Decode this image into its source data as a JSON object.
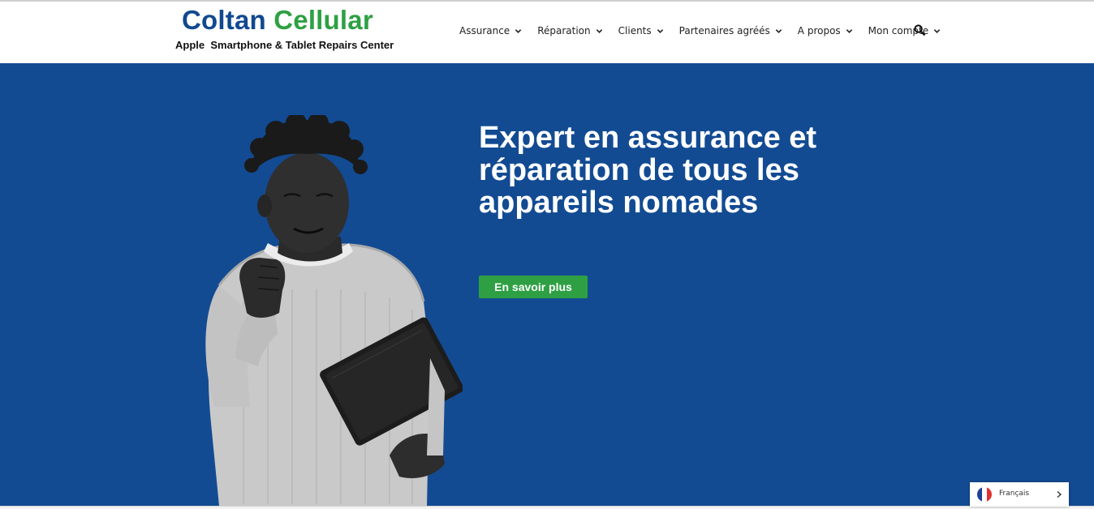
{
  "header": {
    "logo": {
      "title_word1": "Coltan",
      "title_word2": "Cellular",
      "subtitle": "Apple  Smartphone & Tablet Repairs Center"
    },
    "nav": [
      {
        "label": "Assurance",
        "icon": "chevron-down-icon"
      },
      {
        "label": "Réparation",
        "icon": "chevron-down-icon"
      },
      {
        "label": "Clients",
        "icon": "chevron-down-icon"
      },
      {
        "label": "Partenaires agréés",
        "icon": "chevron-down-icon"
      },
      {
        "label": "A propos",
        "icon": "chevron-down-icon"
      },
      {
        "label": "Mon compte",
        "icon": "chevron-down-icon"
      }
    ],
    "search_icon": "search-icon"
  },
  "hero": {
    "title": "Expert en assurance et réparation de tous les appareils nomades",
    "cta_label": "En savoir plus",
    "image": "person-with-tablet-photo"
  },
  "language_switcher": {
    "label": "Français",
    "flag": "france-flag-icon",
    "icon": "chevron-right-icon"
  },
  "colors": {
    "brand_blue": "#134b93",
    "logo_blue": "#11498f",
    "brand_green": "#2ea043",
    "hero_text": "#ffffff"
  }
}
